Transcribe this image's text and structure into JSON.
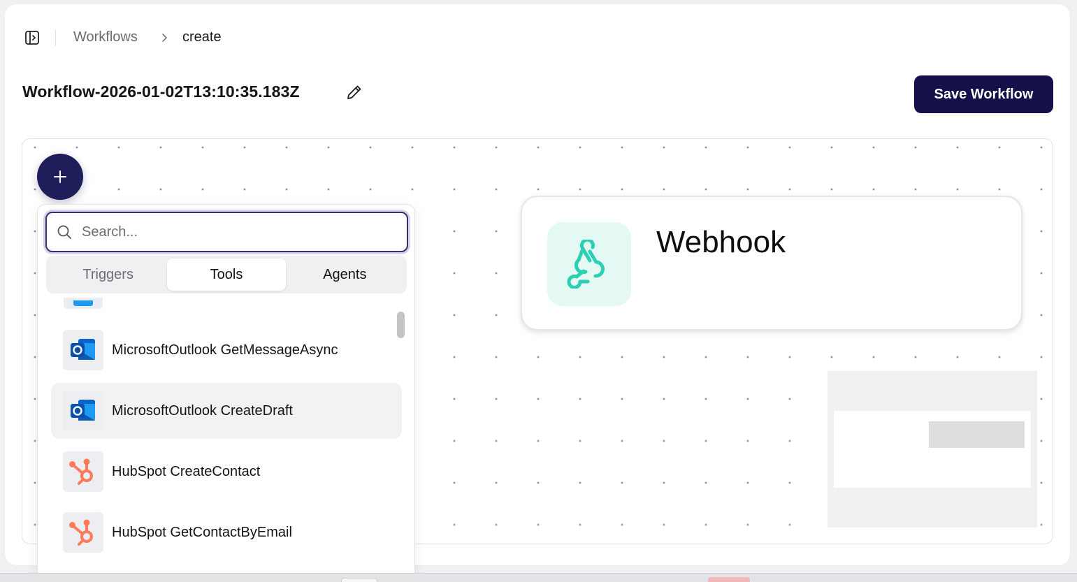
{
  "breadcrumb": {
    "parent": "Workflows",
    "current": "create"
  },
  "workflow": {
    "title": "Workflow-2026-01-02T13:10:35.183Z"
  },
  "toolbar": {
    "save_label": "Save Workflow"
  },
  "colors": {
    "primary": "#14114a",
    "webhook_accent": "#2bd0b2",
    "outlook_blue": "#0a64c9",
    "hubspot_orange": "#ff7a59"
  },
  "canvas": {
    "add_button_symbol": "+",
    "nodes": [
      {
        "label": "Webhook",
        "icon": "webhook-icon"
      }
    ]
  },
  "picker": {
    "search_placeholder": "Search...",
    "tabs": [
      {
        "label": "Triggers",
        "active": false
      },
      {
        "label": "Tools",
        "active": true
      },
      {
        "label": "Agents",
        "active": false
      }
    ],
    "items": [
      {
        "label": "MicrosoftOutlook GetMessageAsync",
        "icon": "outlook-icon"
      },
      {
        "label": "MicrosoftOutlook CreateDraft",
        "icon": "outlook-icon"
      },
      {
        "label": "HubSpot CreateContact",
        "icon": "hubspot-icon"
      },
      {
        "label": "HubSpot GetContactByEmail",
        "icon": "hubspot-icon"
      }
    ]
  }
}
